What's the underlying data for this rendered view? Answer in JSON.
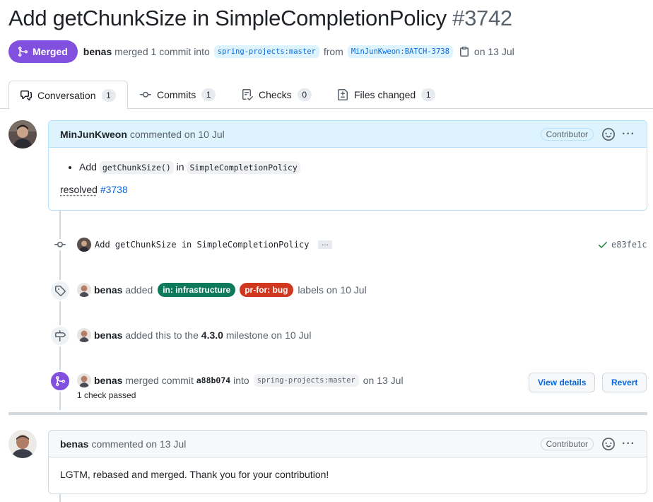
{
  "pr": {
    "title": "Add getChunkSize in SimpleCompletionPolicy",
    "number": "#3742",
    "state": "Merged",
    "author": "benas",
    "merged_text": "merged 1 commit into",
    "base_branch": "spring-projects:master",
    "from_text": "from",
    "head_branch": "MinJunKweon:BATCH-3738",
    "date_text": "on 13 Jul",
    "state_color": "#8250df"
  },
  "tabs": [
    {
      "label": "Conversation",
      "count": "1",
      "icon": "comment-discussion-icon"
    },
    {
      "label": "Commits",
      "count": "1",
      "icon": "git-commit-icon"
    },
    {
      "label": "Checks",
      "count": "0",
      "icon": "checklist-icon"
    },
    {
      "label": "Files changed",
      "count": "1",
      "icon": "file-diff-icon"
    }
  ],
  "comment1": {
    "author": "MinJunKweon",
    "action": "commented on 10 Jul",
    "role": "Contributor",
    "bullet_prefix": "Add",
    "code1": "getChunkSize()",
    "bullet_mid": "in",
    "code2": "SimpleCompletionPolicy",
    "resolved_text": "resolved",
    "resolved_link": "#3738"
  },
  "commit": {
    "message": "Add getChunkSize in SimpleCompletionPolicy",
    "ellipsis": "…",
    "sha": "e83fe1c"
  },
  "labels_event": {
    "actor": "benas",
    "action": "added",
    "labels": [
      {
        "name": "in: infrastructure",
        "color": "#0e7a5b"
      },
      {
        "name": "pr-for: bug",
        "color": "#d1361f"
      }
    ],
    "suffix": "labels on 10 Jul"
  },
  "milestone_event": {
    "actor": "benas",
    "action": "added this to the",
    "milestone": "4.3.0",
    "suffix": "milestone on 10 Jul"
  },
  "merge_event": {
    "actor": "benas",
    "action": "merged commit",
    "sha": "a88b074",
    "into": "into",
    "branch": "spring-projects:master",
    "date": "on 13 Jul",
    "checks": "1 check passed",
    "view_details": "View details",
    "revert": "Revert"
  },
  "comment2": {
    "author": "benas",
    "action": "commented on 13 Jul",
    "role": "Contributor",
    "body": "LGTM, rebased and merged. Thank you for your contribution!"
  }
}
